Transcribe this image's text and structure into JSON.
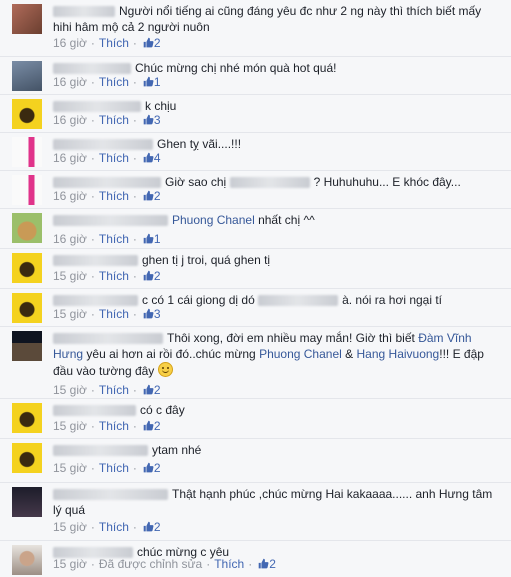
{
  "comments": [
    {
      "name_blur": 62,
      "text": "Người nổi tiếng ai cũng đáng yêu đc như 2 ng này thì thích biết mấy hihi hâm mộ cả 2 người nuôn",
      "time": "16 giờ",
      "like": "Thích",
      "likes": "2"
    },
    {
      "name_blur": 78,
      "text": "Chúc mừng chị nhé món quà hot quá!",
      "time": "16 giờ",
      "like": "Thích",
      "likes": "1"
    },
    {
      "name_blur": 88,
      "text": "k chịu",
      "time": "16 giờ",
      "like": "Thích",
      "likes": "3"
    },
    {
      "name_blur": 100,
      "text": "Ghen tỵ vãi....!!!",
      "time": "16 giờ",
      "like": "Thích",
      "likes": "4"
    },
    {
      "name_blur": 108,
      "text": "Giờ sao chị",
      "text2": "? Huhuhuhu... E khóc đây...",
      "time": "16 giờ",
      "like": "Thích",
      "likes": "2"
    },
    {
      "name_blur": 115,
      "link": "Phuong Chanel",
      "text": "nhất chị ^^",
      "time": "16 giờ",
      "like": "Thích",
      "likes": "1"
    },
    {
      "name_blur": 85,
      "text": "ghen tị j troi, quá ghen tị",
      "time": "15 giờ",
      "like": "Thích",
      "likes": "2"
    },
    {
      "name_blur": 85,
      "text": "c có 1 cái giong dị dó",
      "text2": "à. nói ra hơi ngại tí",
      "time": "15 giờ",
      "like": "Thích",
      "likes": "3"
    },
    {
      "name_blur": 110,
      "text_a": "Thôi xong, đời em nhiều may mắn! Giờ thì biết",
      "link_a": "Đàm Vĩnh Hưng",
      "text_b": "yêu ai hơn ai rồi đó..chúc mừng",
      "link_b": "Phuong Chanel",
      "text_c": "&",
      "link_c": "Hang Haivuong",
      "text_d": "!!! E đập đầu vào tường đây",
      "time": "15 giờ",
      "like": "Thích",
      "likes": "2"
    },
    {
      "name_blur": 83,
      "text": "có c đây",
      "time": "15 giờ",
      "like": "Thích",
      "likes": "2"
    },
    {
      "name_blur": 95,
      "text": "ytam nhé",
      "time": "15 giờ",
      "like": "Thích",
      "likes": "2"
    },
    {
      "name_blur": 115,
      "text": "Thật hạnh phúc ,chúc mừng Hai kakaaaa...... anh Hưng tâm lý quá",
      "time": "15 giờ",
      "like": "Thích",
      "likes": "2"
    },
    {
      "name_blur": 80,
      "text": "chúc mừng c yêu",
      "time": "15 giờ",
      "edited": "Đã được chỉnh sửa",
      "like": "Thích",
      "likes": "2"
    }
  ],
  "colors": {
    "link": "#365899",
    "meta": "#90949c",
    "accent": "#4267b2"
  },
  "icons": {
    "like": "thumbs-up-icon",
    "emoji": "smile-emoji-icon"
  }
}
